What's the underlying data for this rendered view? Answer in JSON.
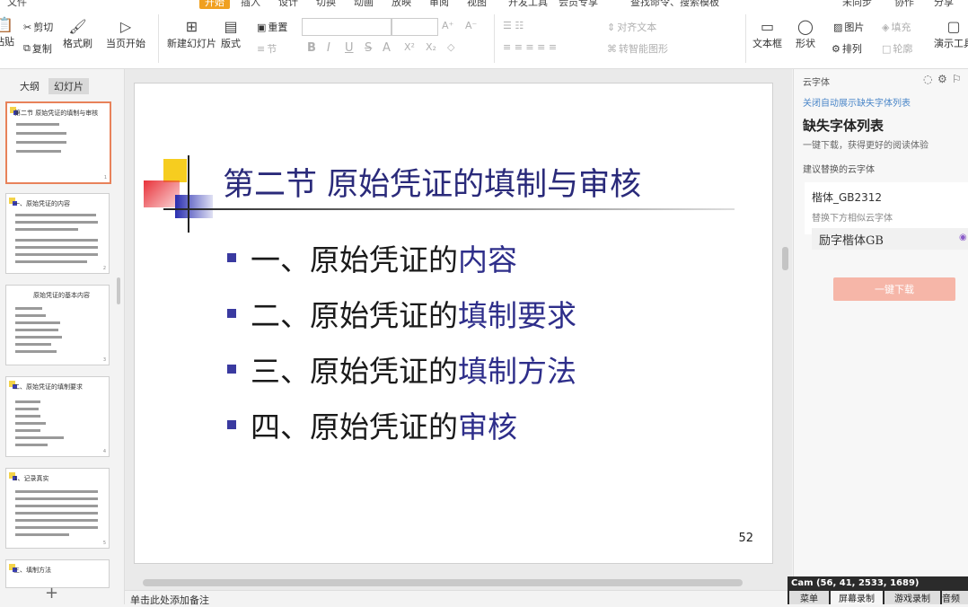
{
  "menubar": {
    "items": [
      "文件",
      "开始",
      "插入",
      "设计",
      "切换",
      "动画",
      "放映",
      "审阅",
      "视图",
      "开发工具",
      "会员专享",
      "查找命令、搜索模板"
    ],
    "right": [
      "未同步",
      "协作",
      "分享"
    ]
  },
  "ribbon": {
    "paste": "粘贴",
    "cut": "剪切",
    "copy": "复制",
    "format_painter": "格式刷",
    "from_current": "当页开始",
    "new_slide": "新建幻灯片",
    "layout": "版式",
    "reset": "重置",
    "section": "节",
    "bold": "B",
    "italic": "I",
    "underline": "U",
    "strike": "S",
    "font_color": "A",
    "superscript": "X²",
    "subscript": "X₂",
    "clear": "◇",
    "grow": "A⁺",
    "shrink": "A⁻",
    "align_text": "对齐文本",
    "smart_shape": "转智能图形",
    "text_box": "文本框",
    "shape": "形状",
    "arrange": "排列",
    "picture": "图片",
    "fill": "填充",
    "outline": "轮廓",
    "presentation_tools": "演示工具"
  },
  "left_panel": {
    "tabs": [
      "大纲",
      "幻灯片"
    ],
    "thumbs": [
      {
        "title": "第二节 原始凭证的填制与审核",
        "selected": true
      },
      {
        "title": "一、原始凭证的内容",
        "selected": false
      },
      {
        "title": "原始凭证的基本内容",
        "selected": false
      },
      {
        "title": "二、原始凭证的填制要求",
        "selected": false
      },
      {
        "title": "1、记录真实",
        "selected": false
      },
      {
        "title": "三、填制方法",
        "selected": false
      }
    ],
    "add": "+"
  },
  "slide": {
    "title": "第二节 原始凭证的填制与审核",
    "bullets": [
      {
        "lead": "一、原始凭证的",
        "hl": "内容"
      },
      {
        "lead": "二、原始凭证的",
        "hl": "填制要求"
      },
      {
        "lead": "三、原始凭证的",
        "hl": "填制方法"
      },
      {
        "lead": "四、原始凭证的",
        "hl": "审核"
      }
    ],
    "page_number": "52"
  },
  "notes": {
    "placeholder": "单击此处添加备注"
  },
  "right_panel": {
    "header": "云字体",
    "close_link": "关闭自动展示缺失字体列表",
    "title": "缺失字体列表",
    "subtitle": "一键下载，获得更好的阅读体验",
    "suggest_label": "建议替换的云字体",
    "missing_font": "楷体_GB2312",
    "replace_hint": "替换下方相似云字体",
    "replacement_font": "励字楷体GB",
    "download_button": "一键下载"
  },
  "cam": {
    "title": "Cam (56, 41, 2533, 1689)",
    "tabs": [
      "菜单",
      "屏幕录制",
      "游戏录制",
      "音频"
    ]
  }
}
